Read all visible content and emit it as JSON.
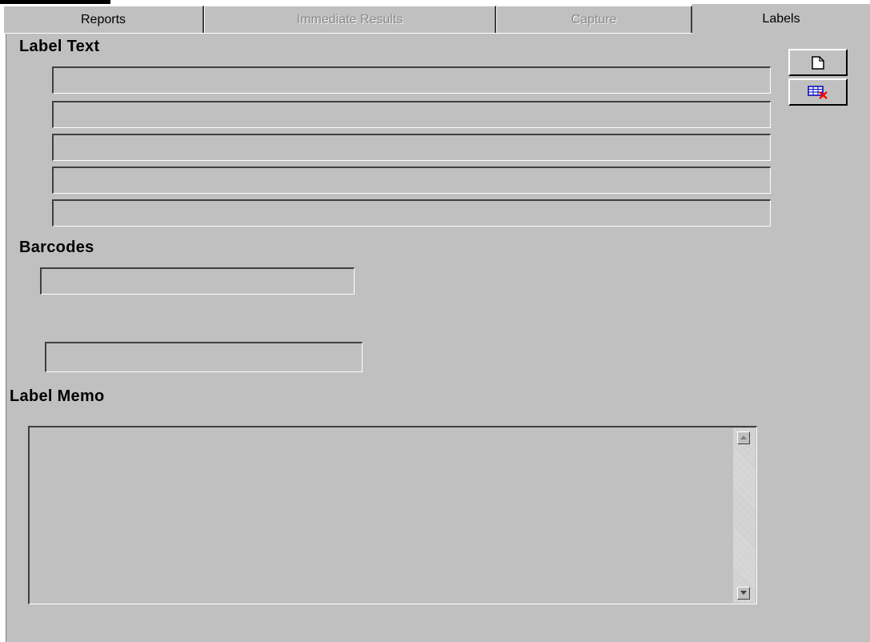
{
  "tabs": {
    "reports": "Reports",
    "immediate_results": "Immediate Results",
    "capture": "Capture",
    "labels": "Labels",
    "active": "Labels"
  },
  "sections": {
    "label_text": "Label Text",
    "barcodes": "Barcodes",
    "label_memo": "Label Memo"
  },
  "label_text_fields": [
    "",
    "",
    "",
    "",
    ""
  ],
  "barcode_fields": [
    "",
    ""
  ],
  "label_memo_value": "",
  "toolbar": {
    "new_icon": "new-document-icon",
    "delete_icon": "delete-label-icon"
  },
  "colors": {
    "panel": "#c0c0c0",
    "disabled_text": "#8a8a8a",
    "delete_accent": "#ff0000",
    "icon_blue": "#0000c0"
  }
}
